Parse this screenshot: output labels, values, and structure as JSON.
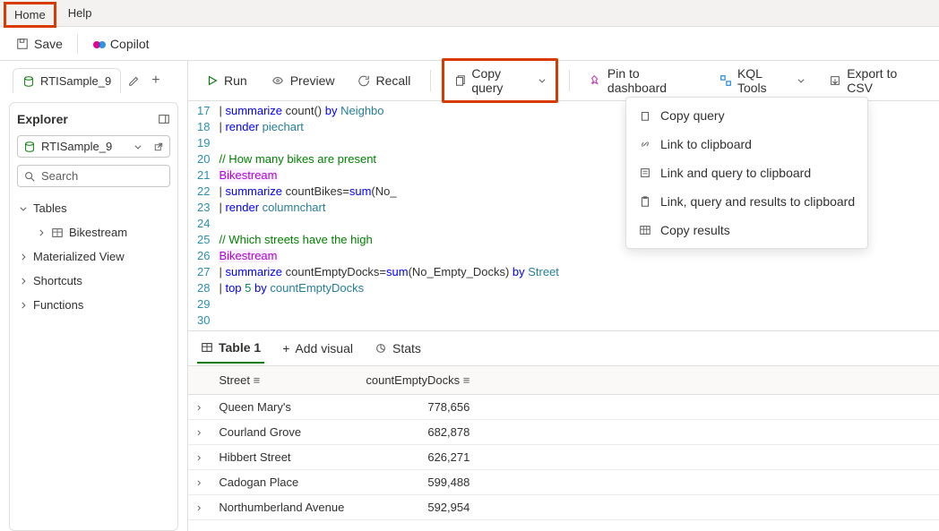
{
  "menubar": {
    "home": "Home",
    "help": "Help"
  },
  "toolbar": {
    "save": "Save",
    "copilot": "Copilot"
  },
  "explorer": {
    "tab": "RTISample_9",
    "title": "Explorer",
    "database": "RTISample_9",
    "search_placeholder": "Search",
    "tree": {
      "tables": "Tables",
      "bikestream": "Bikestream",
      "materialized": "Materialized View",
      "shortcuts": "Shortcuts",
      "functions": "Functions"
    }
  },
  "qtoolbar": {
    "run": "Run",
    "preview": "Preview",
    "recall": "Recall",
    "copy": "Copy query",
    "pin": "Pin to dashboard",
    "kqltools": "KQL Tools",
    "export": "Export to CSV"
  },
  "dropdown": {
    "copy_query": "Copy query",
    "link": "Link to clipboard",
    "link_query": "Link and query to clipboard",
    "link_query_results": "Link, query and results to clipboard",
    "copy_results": "Copy results"
  },
  "editor": {
    "lines": [
      {
        "n": 17,
        "segs": [
          {
            "t": "| ",
            "c": "pipe"
          },
          {
            "t": "summarize",
            "c": "kw"
          },
          {
            "t": " count() ",
            "c": "op"
          },
          {
            "t": "by",
            "c": "kw"
          },
          {
            "t": " Neighbo",
            "c": "col"
          }
        ]
      },
      {
        "n": 18,
        "segs": [
          {
            "t": "| ",
            "c": "pipe"
          },
          {
            "t": "render",
            "c": "kw"
          },
          {
            "t": " piechart",
            "c": "col"
          }
        ]
      },
      {
        "n": 19,
        "segs": []
      },
      {
        "n": 20,
        "segs": [
          {
            "t": "// How many bikes are present ",
            "c": "cmt"
          }
        ]
      },
      {
        "n": 21,
        "segs": [
          {
            "t": "Bikestream",
            "c": "tbl"
          }
        ]
      },
      {
        "n": 22,
        "segs": [
          {
            "t": "| ",
            "c": "pipe"
          },
          {
            "t": "summarize",
            "c": "kw"
          },
          {
            "t": " countBikes=",
            "c": "op"
          },
          {
            "t": "sum",
            "c": "fn"
          },
          {
            "t": "(No_",
            "c": "op"
          }
        ]
      },
      {
        "n": 23,
        "segs": [
          {
            "t": "| ",
            "c": "pipe"
          },
          {
            "t": "render",
            "c": "kw"
          },
          {
            "t": " columnchart",
            "c": "col"
          }
        ]
      },
      {
        "n": 24,
        "segs": []
      },
      {
        "n": 25,
        "segs": [
          {
            "t": "// Which streets have the high",
            "c": "cmt"
          }
        ]
      },
      {
        "n": 26,
        "segs": [
          {
            "t": "Bikestream",
            "c": "tbl"
          }
        ]
      },
      {
        "n": 27,
        "segs": [
          {
            "t": "| ",
            "c": "pipe"
          },
          {
            "t": "summarize",
            "c": "kw"
          },
          {
            "t": " countEmptyDocks=",
            "c": "op"
          },
          {
            "t": "sum",
            "c": "fn"
          },
          {
            "t": "(No_Empty_Docks) ",
            "c": "op"
          },
          {
            "t": "by",
            "c": "kw"
          },
          {
            "t": " Street",
            "c": "col"
          }
        ]
      },
      {
        "n": 28,
        "segs": [
          {
            "t": "| ",
            "c": "pipe"
          },
          {
            "t": "top",
            "c": "kw"
          },
          {
            "t": " 5 ",
            "c": "num"
          },
          {
            "t": "by",
            "c": "kw"
          },
          {
            "t": " countEmptyDocks",
            "c": "col"
          }
        ]
      },
      {
        "n": 29,
        "segs": []
      },
      {
        "n": 30,
        "segs": []
      }
    ]
  },
  "results": {
    "tabs": {
      "table1": "Table 1",
      "add_visual": "Add visual",
      "stats": "Stats"
    },
    "columns": [
      "Street",
      "countEmptyDocks"
    ],
    "rows": [
      {
        "street": "Queen Mary's",
        "count": "778,656"
      },
      {
        "street": "Courland Grove",
        "count": "682,878"
      },
      {
        "street": "Hibbert Street",
        "count": "626,271"
      },
      {
        "street": "Cadogan Place",
        "count": "599,488"
      },
      {
        "street": "Northumberland Avenue",
        "count": "592,954"
      }
    ]
  }
}
